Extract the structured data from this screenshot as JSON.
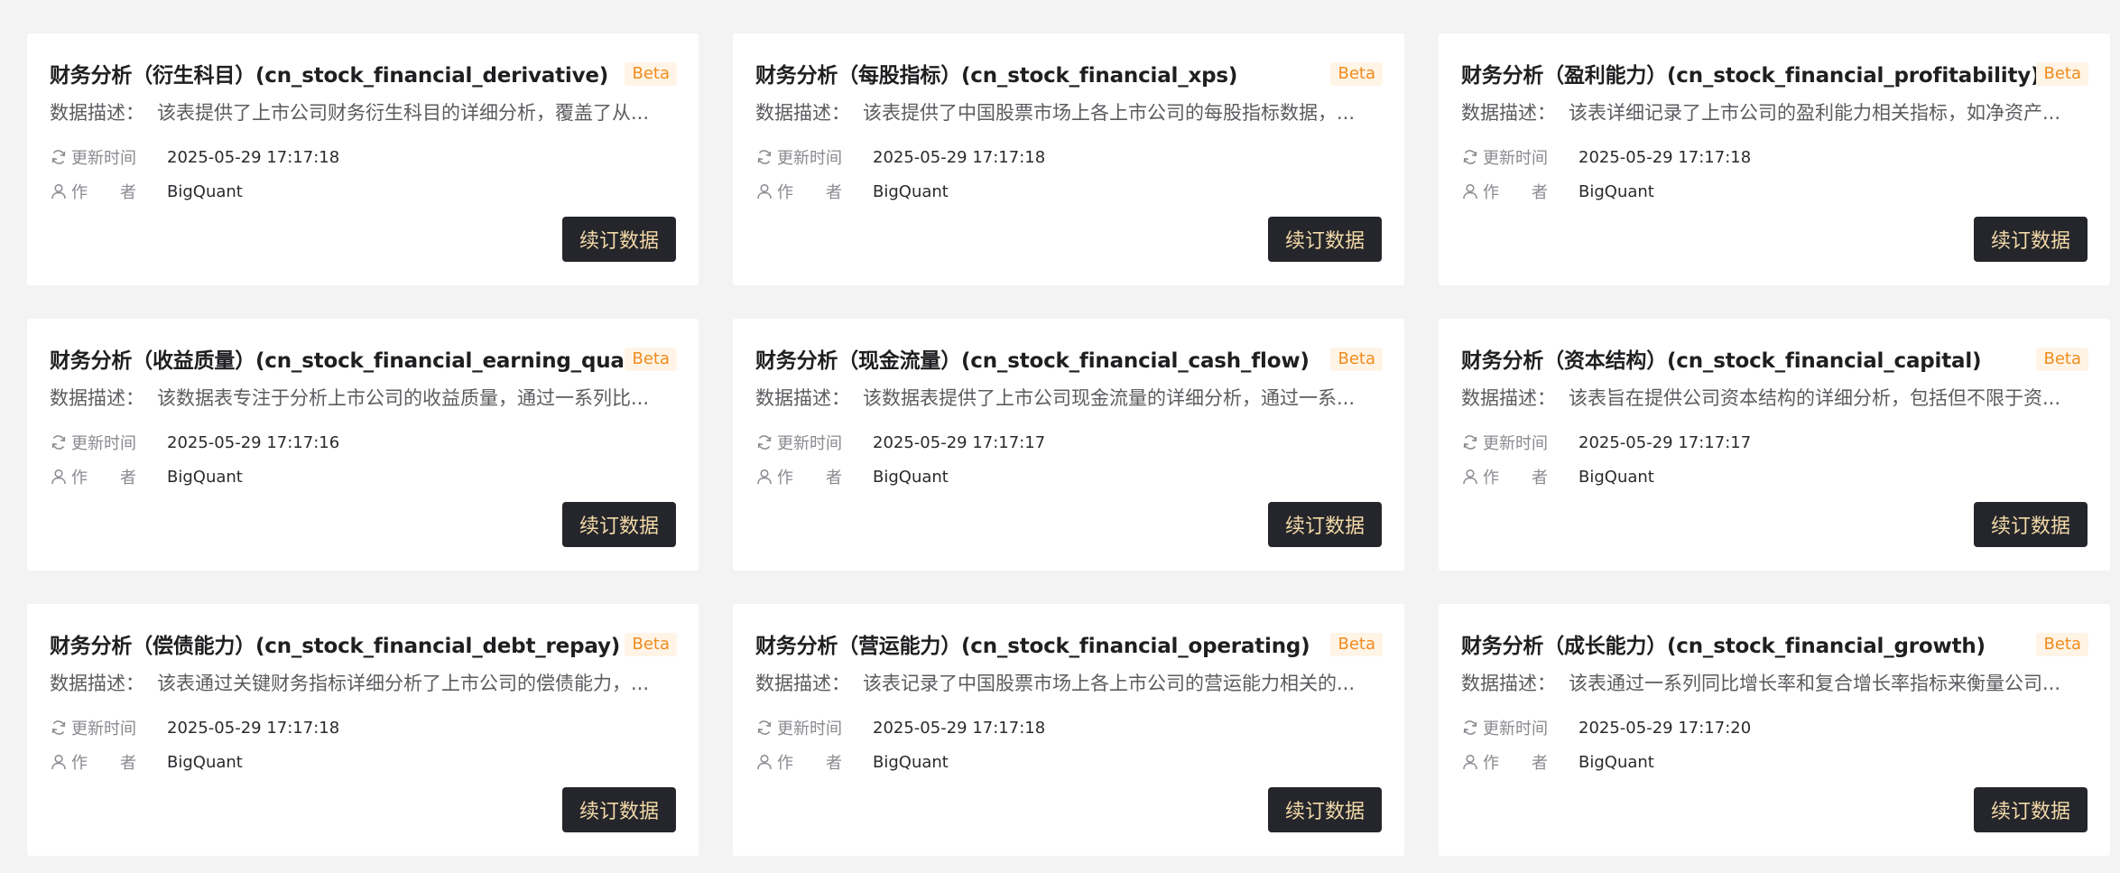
{
  "labels": {
    "desc_label": "数据描述：",
    "time_label": "更新时间",
    "author_label": "作　　者",
    "badge": "Beta",
    "button": "续订数据"
  },
  "cards": [
    {
      "title": "财务分析（衍生科目）(cn_stock_financial_derivative)",
      "desc": "该表提供了上市公司财务衍生科目的详细分析，覆盖了从...",
      "time": "2025-05-29 17:17:18",
      "author": "BigQuant"
    },
    {
      "title": "财务分析（每股指标）(cn_stock_financial_xps)",
      "desc": "该表提供了中国股票市场上各上市公司的每股指标数据，...",
      "time": "2025-05-29 17:17:18",
      "author": "BigQuant"
    },
    {
      "title": "财务分析（盈利能力）(cn_stock_financial_profitability)",
      "desc": "该表详细记录了上市公司的盈利能力相关指标，如净资产...",
      "time": "2025-05-29 17:17:18",
      "author": "BigQuant"
    },
    {
      "title": "财务分析（收益质量）(cn_stock_financial_earning_quality)",
      "desc": "该数据表专注于分析上市公司的收益质量，通过一系列比...",
      "time": "2025-05-29 17:17:16",
      "author": "BigQuant"
    },
    {
      "title": "财务分析（现金流量）(cn_stock_financial_cash_flow)",
      "desc": "该数据表提供了上市公司现金流量的详细分析，通过一系...",
      "time": "2025-05-29 17:17:17",
      "author": "BigQuant"
    },
    {
      "title": "财务分析（资本结构）(cn_stock_financial_capital)",
      "desc": "该表旨在提供公司资本结构的详细分析，包括但不限于资...",
      "time": "2025-05-29 17:17:17",
      "author": "BigQuant"
    },
    {
      "title": "财务分析（偿债能力）(cn_stock_financial_debt_repay)",
      "desc": "该表通过关键财务指标详细分析了上市公司的偿债能力，...",
      "time": "2025-05-29 17:17:18",
      "author": "BigQuant"
    },
    {
      "title": "财务分析（营运能力）(cn_stock_financial_operating)",
      "desc": "该表记录了中国股票市场上各上市公司的营运能力相关的...",
      "time": "2025-05-29 17:17:18",
      "author": "BigQuant"
    },
    {
      "title": "财务分析（成长能力）(cn_stock_financial_growth)",
      "desc": "该表通过一系列同比增长率和复合增长率指标来衡量公司...",
      "time": "2025-05-29 17:17:20",
      "author": "BigQuant"
    }
  ],
  "colors": {
    "background": "#f3f3f4",
    "card": "#ffffff",
    "badge_text": "#f08c1e",
    "badge_bg": "#fff4e6",
    "button_bg": "#25262b",
    "button_text": "#f3d9a8"
  },
  "icons": {
    "time": "refresh-icon",
    "author": "user-icon"
  }
}
